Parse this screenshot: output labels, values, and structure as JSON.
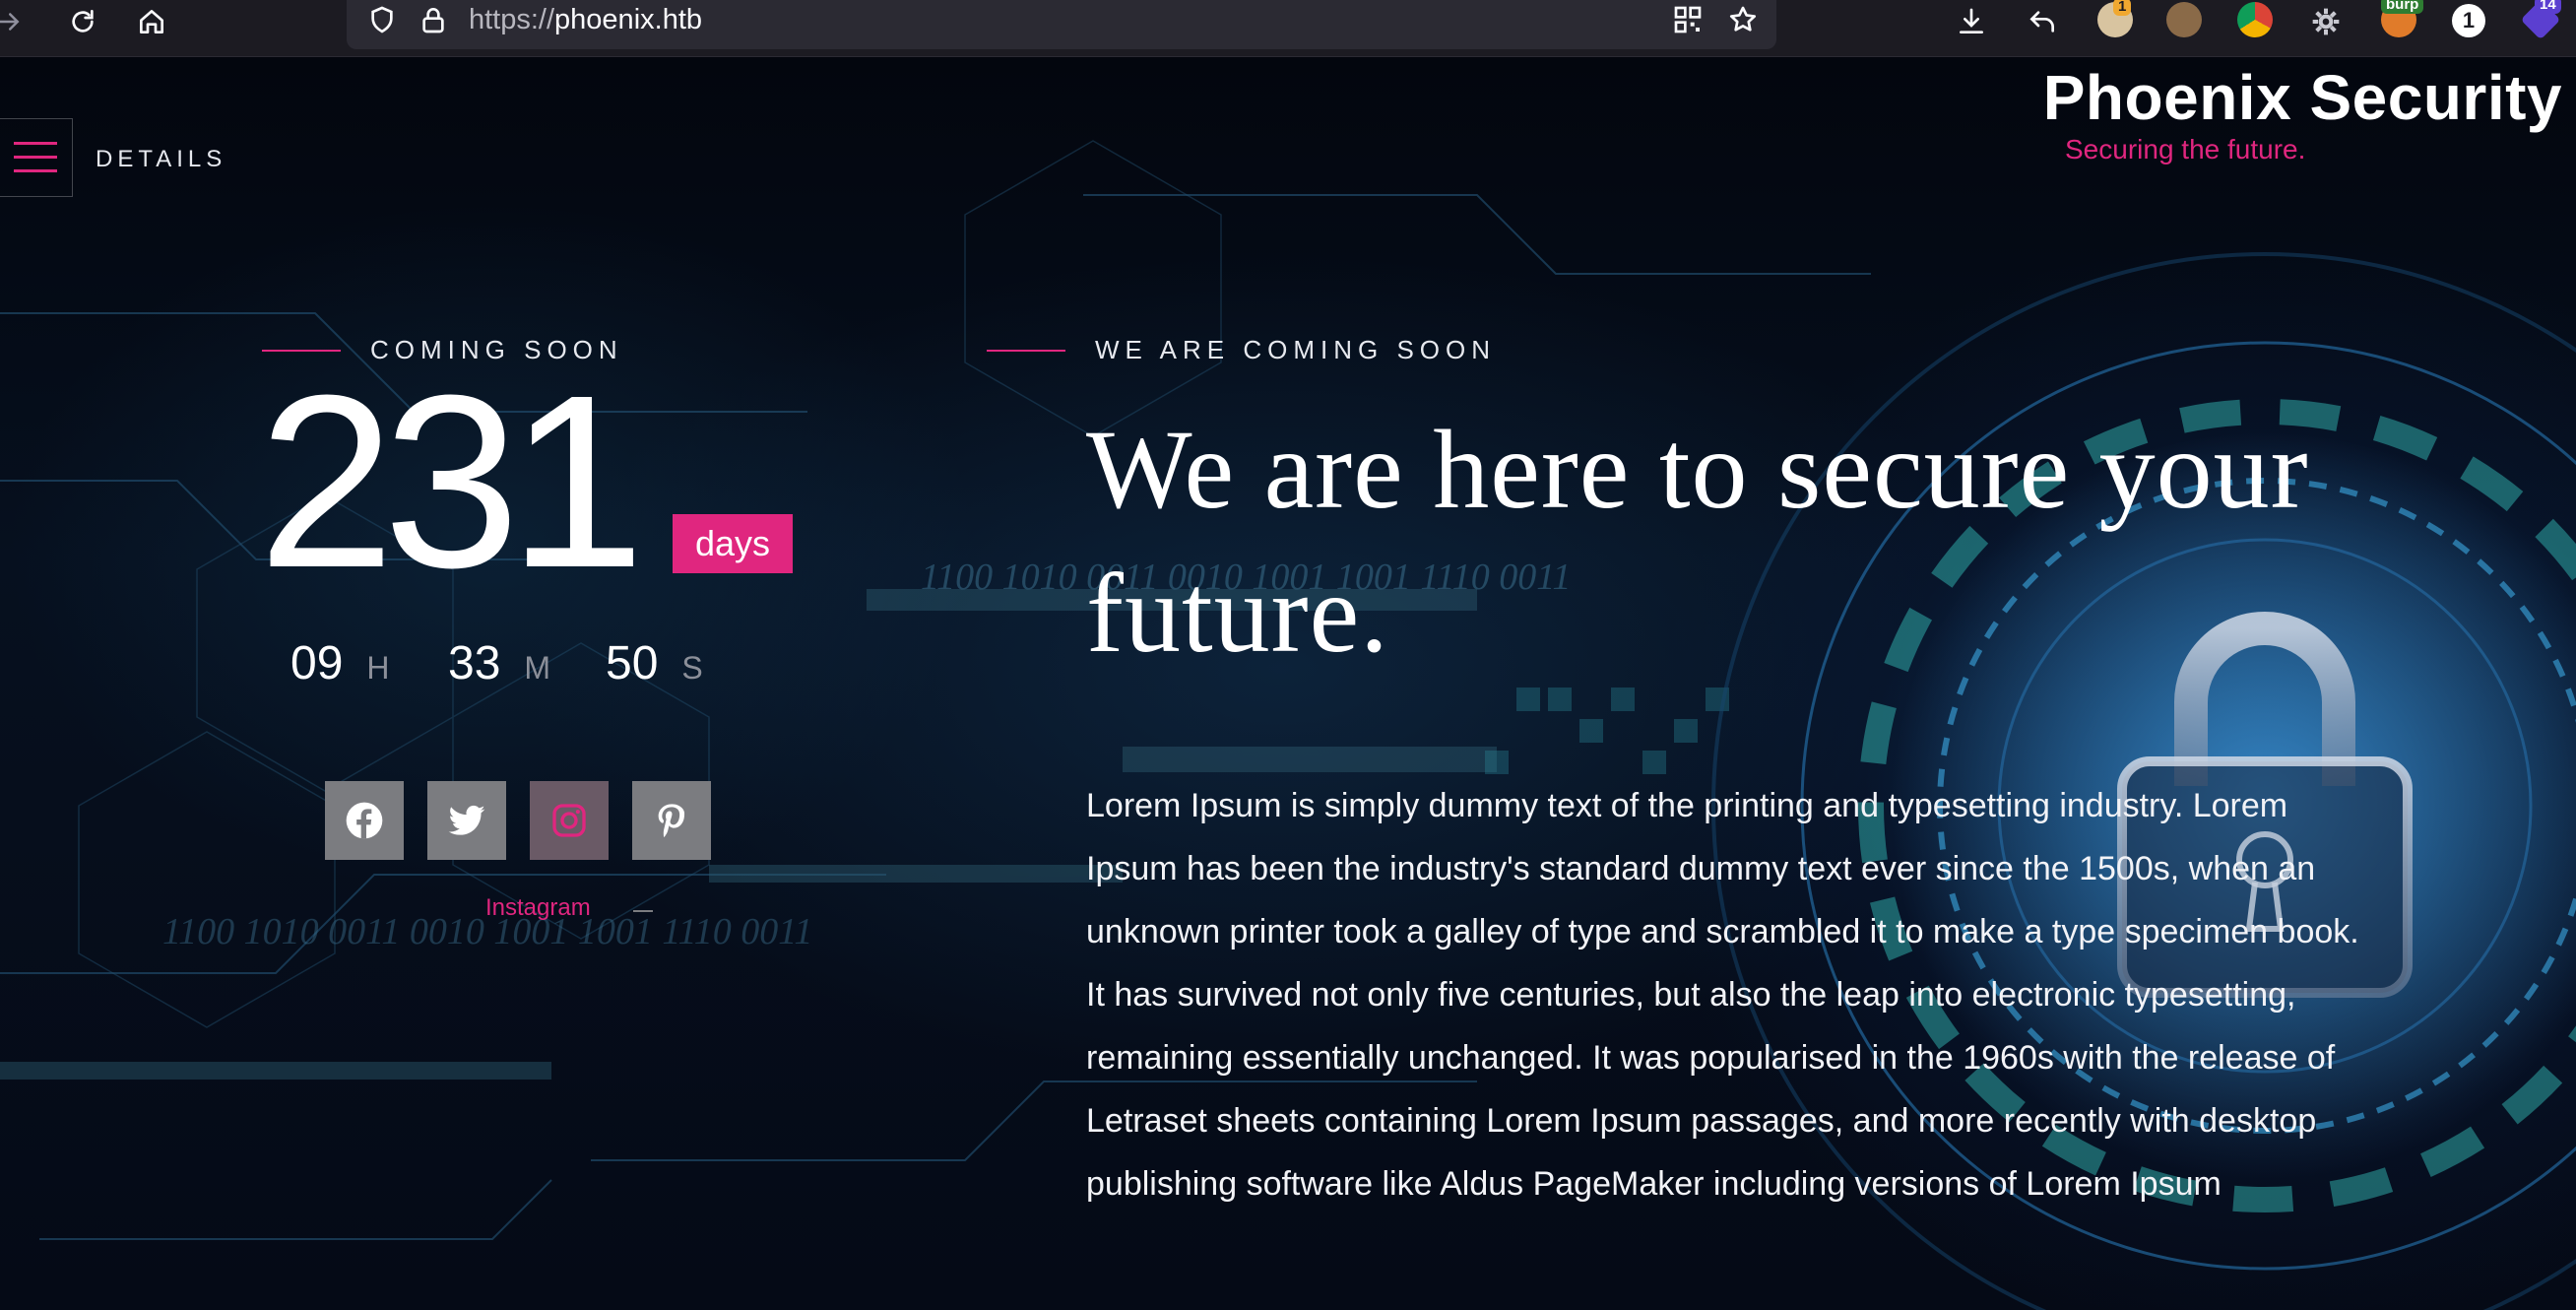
{
  "browser": {
    "url_scheme": "https://",
    "url_host": "phoenix.htb",
    "extension_badges": [
      "1",
      "burp",
      "1",
      "14"
    ]
  },
  "nav": {
    "details_label": "DETAILS"
  },
  "brand": {
    "title": "Phoenix Security",
    "subtitle": "Securing the future."
  },
  "countdown": {
    "eyebrow": "COMING SOON",
    "days": "231",
    "days_label": "days",
    "hours": "09",
    "hours_label": "H",
    "minutes": "33",
    "minutes_label": "M",
    "seconds": "50",
    "seconds_label": "S"
  },
  "social": {
    "icons": [
      "facebook-icon",
      "twitter-icon",
      "instagram-icon",
      "pinterest-icon"
    ],
    "hover_caption": "Instagram"
  },
  "main": {
    "eyebrow": "WE ARE COMING SOON",
    "headline": "We are here to secure your future.",
    "paragraph": "Lorem Ipsum is simply dummy text of the printing and typesetting industry. Lorem Ipsum has been the industry's standard dummy text ever since the 1500s, when an unknown printer took a galley of type and scrambled it to make a type specimen book. It has survived not only five centuries, but also the leap into electronic typesetting, remaining essentially unchanged. It was popularised in the 1960s with the release of Letraset sheets containing Lorem Ipsum passages, and more recently with desktop publishing software like Aldus PageMaker including versions of Lorem Ipsum"
  },
  "background": {
    "binary_text_1": "1100 1010 0011 0010 1001 1001 1110 0011",
    "binary_text_2": "1100 1010 0011 0010 1001 1001 1110 0011"
  },
  "colors": {
    "accent": "#e0267f",
    "toolbar": "#1c1b22",
    "urlbar": "#2b2a33",
    "social_bg": "#7b7c80"
  }
}
